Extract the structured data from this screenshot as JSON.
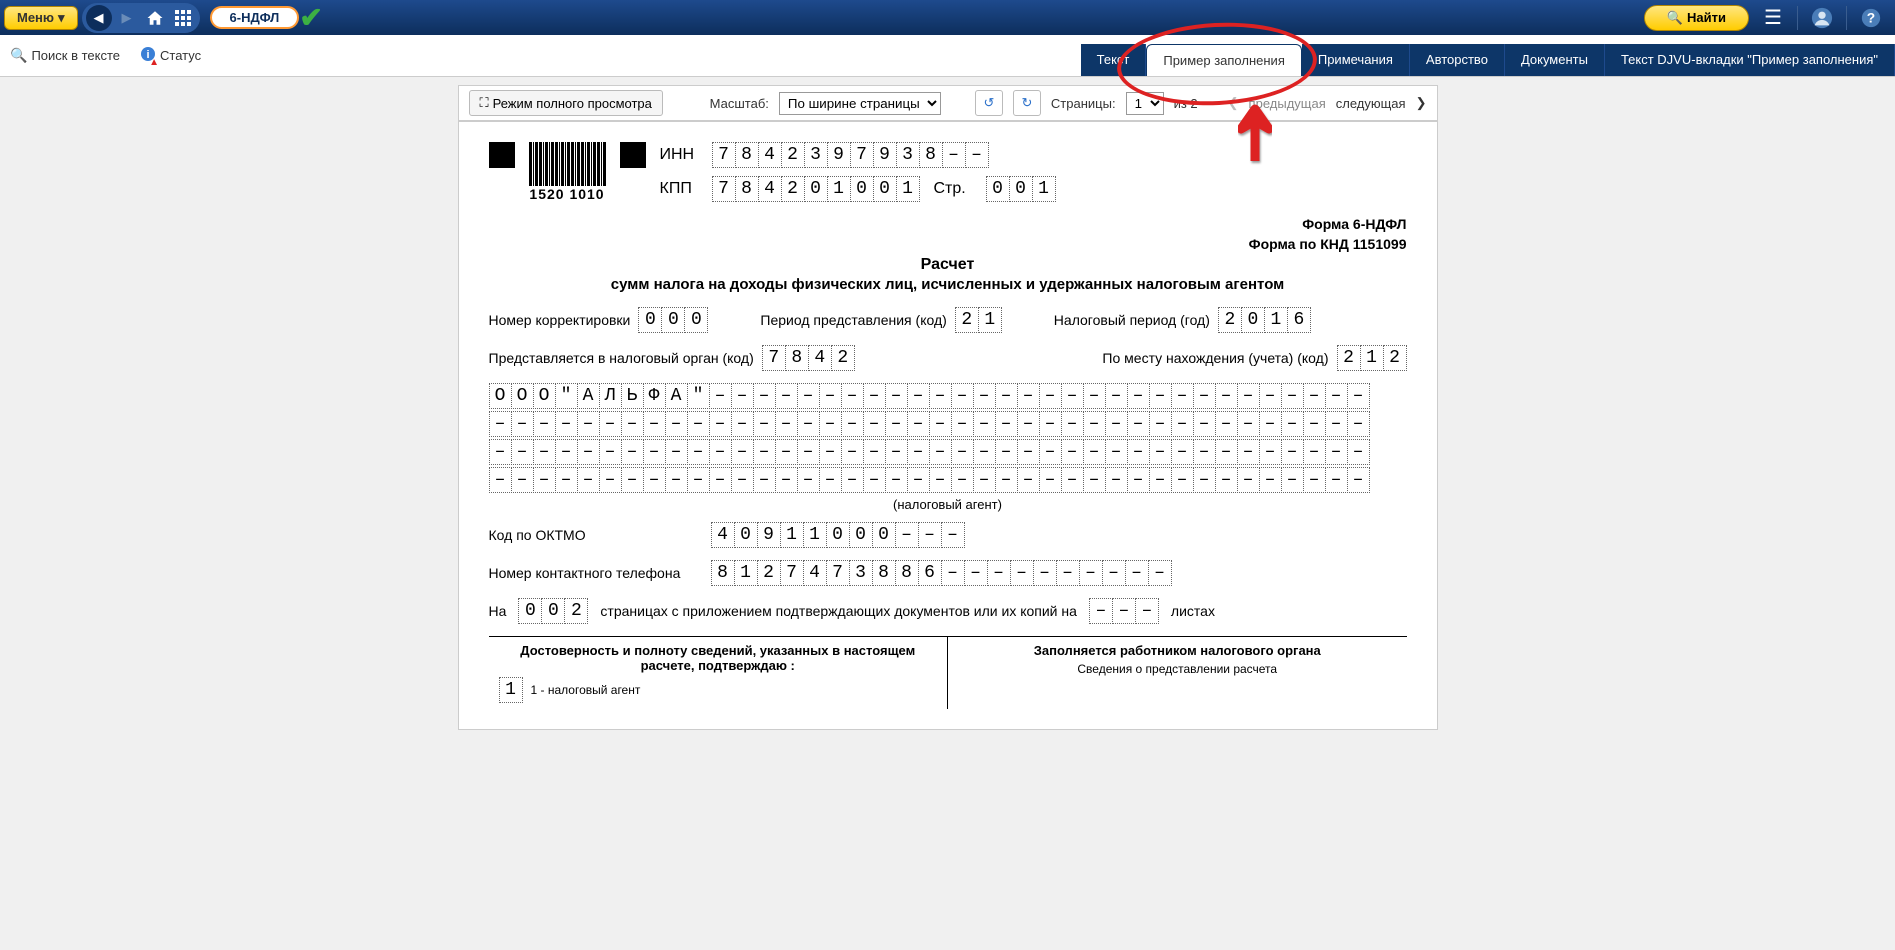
{
  "topbar": {
    "menu_label": "Меню",
    "search_pill": "6-НДФЛ",
    "find_label": "Найти"
  },
  "secondbar": {
    "search_text": "Поиск в тексте",
    "status": "Статус"
  },
  "tabs": {
    "t0": "Текст",
    "t1": "Пример заполнения",
    "t2": "Примечания",
    "t3": "Авторство",
    "t4": "Документы",
    "t5": "Текст DJVU-вкладки \"Пример заполнения\""
  },
  "viewer": {
    "fullscreen": "Режим полного просмотра",
    "scale_label": "Масштаб:",
    "scale_value": "По ширине страницы",
    "pages_label": "Страницы:",
    "page_current": "1",
    "page_of": "из 2",
    "prev": "предыдущая",
    "next": "следующая"
  },
  "form": {
    "barcode_num": "1520 1010",
    "inn_label": "ИНН",
    "inn": [
      "7",
      "8",
      "4",
      "2",
      "3",
      "9",
      "7",
      "9",
      "3",
      "8",
      "–",
      "–"
    ],
    "kpp_label": "КПП",
    "kpp": [
      "7",
      "8",
      "4",
      "2",
      "0",
      "1",
      "0",
      "0",
      "1"
    ],
    "str_label": "Стр.",
    "str": [
      "0",
      "0",
      "1"
    ],
    "form_label": "Форма 6-НДФЛ",
    "knd_label": "Форма по КНД 1151099",
    "title": "Расчет",
    "subtitle": "сумм налога на доходы физических лиц, исчисленных и удержанных налоговым агентом",
    "corr_label": "Номер корректировки",
    "corr": [
      "0",
      "0",
      "0"
    ],
    "period_label": "Период представления (код)",
    "period": [
      "2",
      "1"
    ],
    "year_label": "Налоговый период (год)",
    "year": [
      "2",
      "0",
      "1",
      "6"
    ],
    "organ_label": "Представляется в налоговый орган (код)",
    "organ": [
      "7",
      "8",
      "4",
      "2"
    ],
    "place_label": "По месту нахождения (учета) (код)",
    "place": [
      "2",
      "1",
      "2"
    ],
    "name1": [
      "О",
      "О",
      "О",
      "\"",
      "А",
      "Л",
      "Ь",
      "Ф",
      "А",
      "\"",
      "–",
      "–",
      "–",
      "–",
      "–",
      "–",
      "–",
      "–",
      "–",
      "–",
      "–",
      "–",
      "–",
      "–",
      "–",
      "–",
      "–",
      "–",
      "–",
      "–",
      "–",
      "–",
      "–",
      "–",
      "–",
      "–",
      "–",
      "–",
      "–",
      "–"
    ],
    "dash40": [
      "–",
      "–",
      "–",
      "–",
      "–",
      "–",
      "–",
      "–",
      "–",
      "–",
      "–",
      "–",
      "–",
      "–",
      "–",
      "–",
      "–",
      "–",
      "–",
      "–",
      "–",
      "–",
      "–",
      "–",
      "–",
      "–",
      "–",
      "–",
      "–",
      "–",
      "–",
      "–",
      "–",
      "–",
      "–",
      "–",
      "–",
      "–",
      "–",
      "–"
    ],
    "agent": "(налоговый агент)",
    "oktmo_label": "Код по ОКТМО",
    "oktmo": [
      "4",
      "0",
      "9",
      "1",
      "1",
      "0",
      "0",
      "0",
      "–",
      "–",
      "–"
    ],
    "phone_label": "Номер контактного телефона",
    "phone": [
      "8",
      "1",
      "2",
      "7",
      "4",
      "7",
      "3",
      "8",
      "8",
      "6",
      "–",
      "–",
      "–",
      "–",
      "–",
      "–",
      "–",
      "–",
      "–",
      "–"
    ],
    "on_label": "На",
    "pages": [
      "0",
      "0",
      "2"
    ],
    "pages_tail": "страницах с приложением подтверждающих документов или их копий на",
    "att": [
      "–",
      "–",
      "–"
    ],
    "sheets": "листах",
    "left_head": "Достоверность и полноту сведений, указанных в настоящем расчете, подтверждаю :",
    "left_opt1_num": "1",
    "left_opt1": "1 - налоговый агент",
    "right_head": "Заполняется работником налогового органа",
    "right_sub": "Сведения о представлении расчета"
  }
}
